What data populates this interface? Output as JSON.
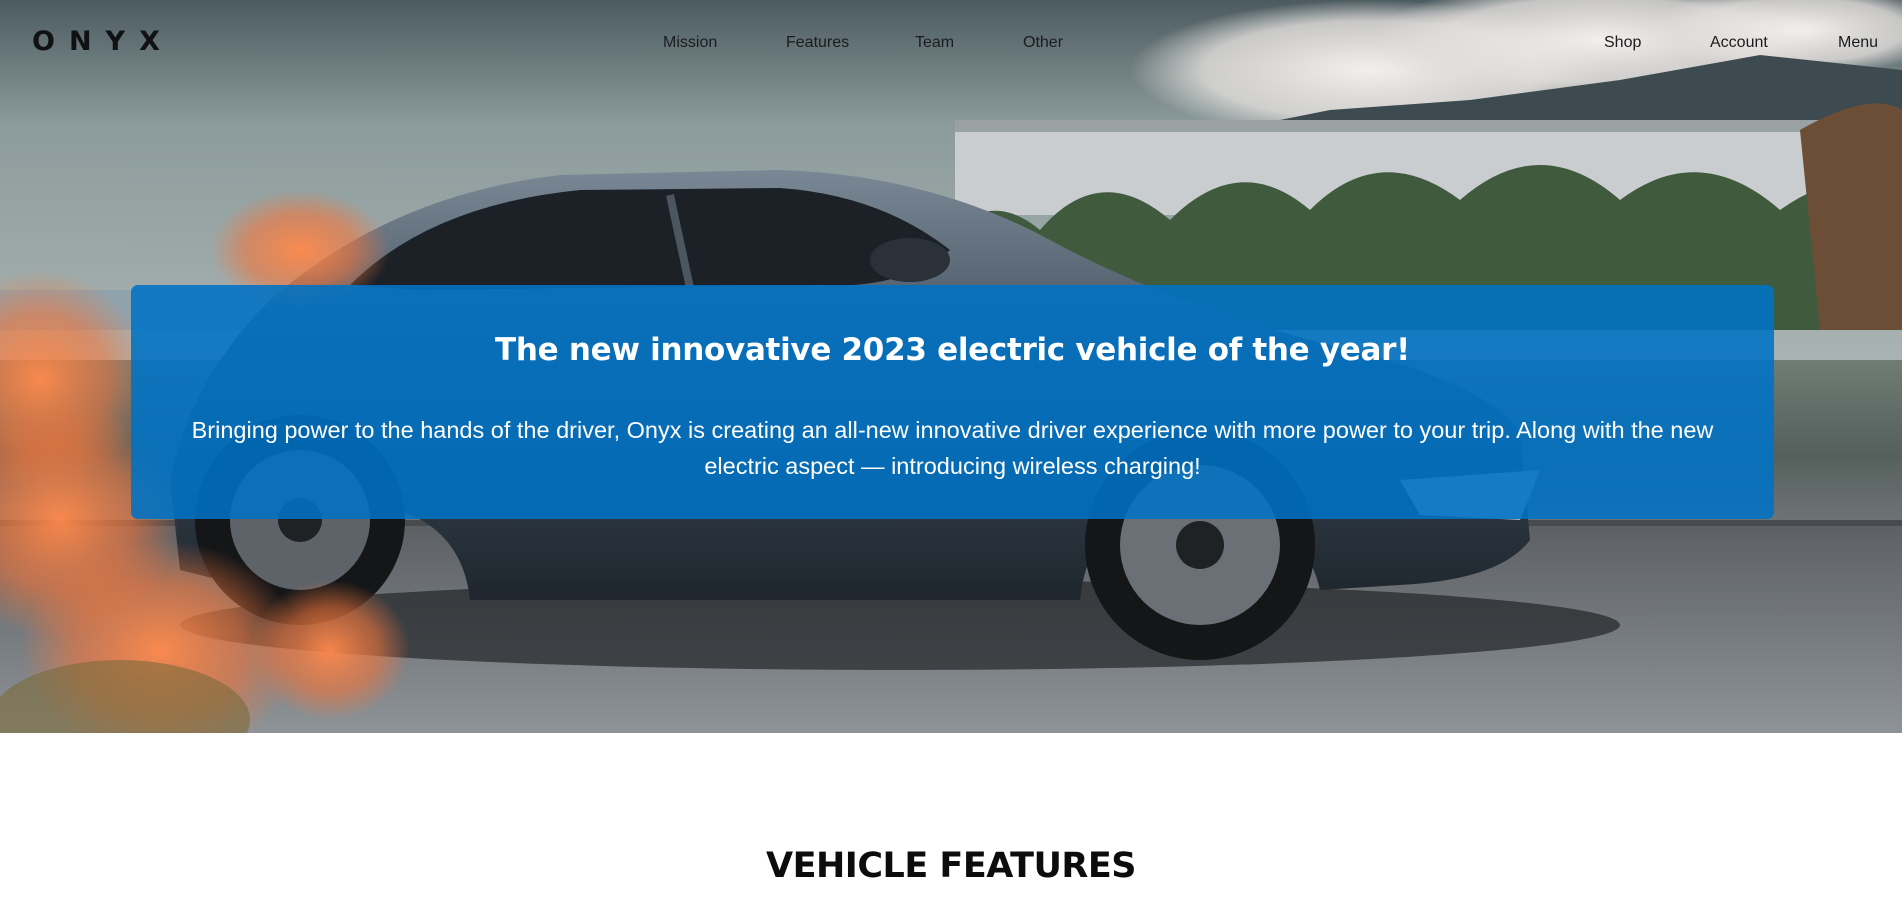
{
  "brand": {
    "logo": "ONYX"
  },
  "nav": {
    "center_links": [
      "Mission",
      "Features",
      "Team",
      "Other"
    ],
    "right_links": [
      "Shop",
      "Account",
      "Menu"
    ]
  },
  "hero": {
    "title": "The new innovative 2023 electric vehicle of the year!",
    "description": "Bringing power to the hands of the driver, Onyx is creating an all-new innovative driver experience with more power to your trip. Along with the new electric aspect — introducing wireless charging!",
    "banner_color": "#0072c4"
  },
  "features": {
    "heading": "VEHICLE FEATURES"
  },
  "colors": {
    "accent": "#0072c4",
    "text_dark": "#0c0c0c",
    "background": "#ffffff"
  }
}
